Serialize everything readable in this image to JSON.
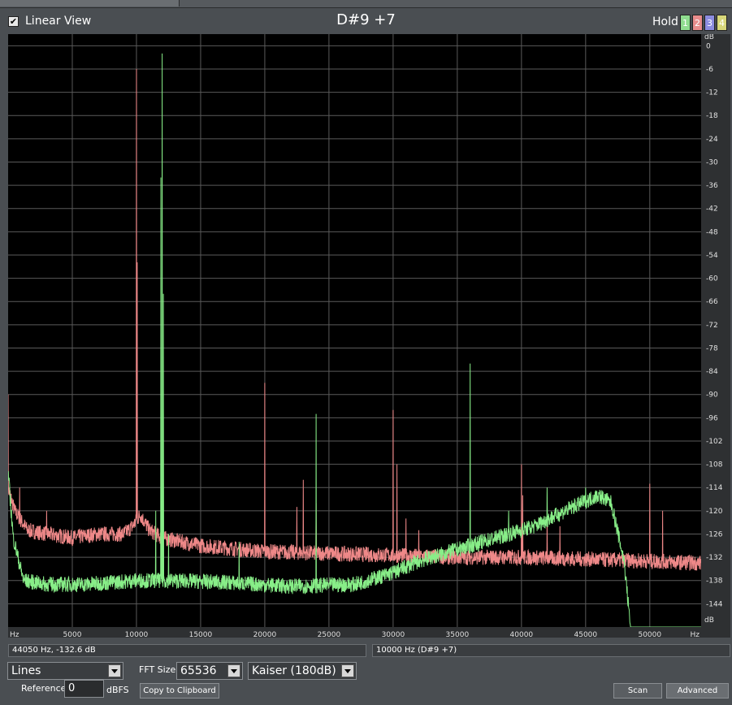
{
  "header": {
    "linear_view_label": "Linear View",
    "linear_view_checked": true,
    "title": "D#9 +7",
    "hold_label": "Hold",
    "hold_buttons": [
      {
        "label": "1",
        "color": "#8fdc8f"
      },
      {
        "label": "2",
        "color": "#e88c8c"
      },
      {
        "label": "3",
        "color": "#8c8ce0"
      },
      {
        "label": "4",
        "color": "#d6d67a"
      }
    ]
  },
  "status": {
    "cursor": "44050 Hz, -132.6 dB",
    "note": "10000 Hz (D#9 +7)"
  },
  "controls": {
    "display_mode": "Lines",
    "fft_size_label": "FFT Size",
    "fft_size": "65536",
    "window": "Kaiser (180dB)",
    "reference_label": "Reference",
    "reference_value": "0",
    "reference_unit": "dBFS",
    "copy_button": "Copy to Clipboard",
    "scan_button": "Scan",
    "advanced_button": "Advanced"
  },
  "chart_data": {
    "type": "line",
    "xlim": [
      0,
      54000
    ],
    "ylim": [
      -150,
      3
    ],
    "x_unit": "Hz",
    "y_unit": "dB",
    "x_ticks": [
      5000,
      10000,
      15000,
      20000,
      25000,
      30000,
      35000,
      40000,
      45000,
      50000
    ],
    "y_ticks": [
      0,
      -6,
      -12,
      -18,
      -24,
      -30,
      -36,
      -42,
      -48,
      -54,
      -60,
      -66,
      -72,
      -78,
      -84,
      -90,
      -96,
      -102,
      -108,
      -114,
      -120,
      -126,
      -132,
      -138,
      -144
    ],
    "grid": true,
    "colors": {
      "red": "#ee8888",
      "green": "#88ee88",
      "grid": "#5a5a5a"
    },
    "series": [
      {
        "color": "#ee8888",
        "floor": [
          [
            0,
            -114
          ],
          [
            500,
            -120
          ],
          [
            1500,
            -125
          ],
          [
            3000,
            -126
          ],
          [
            5000,
            -127
          ],
          [
            7000,
            -126
          ],
          [
            9000,
            -126
          ],
          [
            9700,
            -124
          ],
          [
            10300,
            -121
          ],
          [
            11000,
            -125
          ],
          [
            12000,
            -127
          ],
          [
            15000,
            -129
          ],
          [
            20000,
            -130.5
          ],
          [
            25000,
            -131
          ],
          [
            30000,
            -131.5
          ],
          [
            35000,
            -132
          ],
          [
            40000,
            -132
          ],
          [
            45000,
            -132.5
          ],
          [
            50000,
            -133
          ],
          [
            54000,
            -133.5
          ]
        ],
        "peaks": [
          [
            0,
            -90
          ],
          [
            900,
            -114
          ],
          [
            3000,
            -120
          ],
          [
            10000,
            -6
          ],
          [
            10050,
            -56
          ],
          [
            20000,
            -87
          ],
          [
            22500,
            -119
          ],
          [
            23000,
            -112
          ],
          [
            24000,
            -118
          ],
          [
            30000,
            -94
          ],
          [
            30300,
            -108
          ],
          [
            31000,
            -122
          ],
          [
            32000,
            -125
          ],
          [
            40000,
            -108
          ],
          [
            40100,
            -116
          ],
          [
            42000,
            -122
          ],
          [
            43000,
            -124
          ],
          [
            50000,
            -113
          ],
          [
            51000,
            -120
          ]
        ]
      },
      {
        "color": "#88ee88",
        "floor": [
          [
            0,
            -110
          ],
          [
            400,
            -127
          ],
          [
            1200,
            -138
          ],
          [
            3000,
            -139
          ],
          [
            6000,
            -139
          ],
          [
            10000,
            -138
          ],
          [
            13000,
            -138
          ],
          [
            17000,
            -138.5
          ],
          [
            22000,
            -139.5
          ],
          [
            27000,
            -139
          ],
          [
            30000,
            -136
          ],
          [
            32000,
            -133
          ],
          [
            35000,
            -130
          ],
          [
            38000,
            -127
          ],
          [
            41000,
            -124
          ],
          [
            44000,
            -119
          ],
          [
            46000,
            -116
          ],
          [
            47000,
            -118
          ],
          [
            48000,
            -133
          ],
          [
            48500,
            -150
          ],
          [
            54000,
            -150
          ]
        ],
        "peaks": [
          [
            12000,
            -2
          ],
          [
            11900,
            -34
          ],
          [
            12100,
            -64
          ],
          [
            11500,
            -120
          ],
          [
            12500,
            -126
          ],
          [
            18000,
            -128
          ],
          [
            24000,
            -95
          ],
          [
            36000,
            -82
          ],
          [
            39000,
            -120
          ],
          [
            42000,
            -114
          ],
          [
            45000,
            -114
          ]
        ]
      }
    ]
  }
}
